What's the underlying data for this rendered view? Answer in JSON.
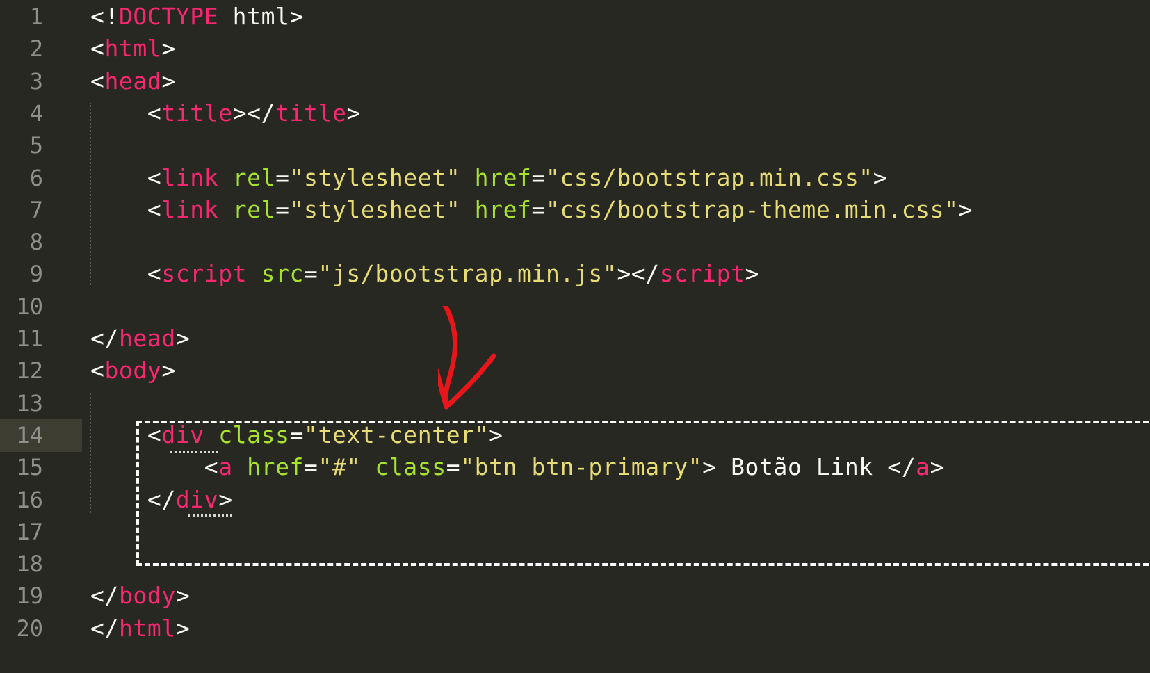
{
  "editor": {
    "active_line": 14,
    "lines": [
      {
        "n": "1",
        "tokens": [
          {
            "c": "p",
            "t": "<!"
          },
          {
            "c": "t",
            "t": "DOCTYPE"
          },
          {
            "c": "w",
            "t": " html"
          },
          {
            "c": "p",
            "t": ">"
          }
        ]
      },
      {
        "n": "2",
        "tokens": [
          {
            "c": "p",
            "t": "<"
          },
          {
            "c": "t",
            "t": "html"
          },
          {
            "c": "p",
            "t": ">"
          }
        ]
      },
      {
        "n": "3",
        "tokens": [
          {
            "c": "p",
            "t": "<"
          },
          {
            "c": "t",
            "t": "head"
          },
          {
            "c": "p",
            "t": ">"
          }
        ]
      },
      {
        "n": "4",
        "tokens": [
          {
            "c": "p",
            "t": "    <"
          },
          {
            "c": "t",
            "t": "title"
          },
          {
            "c": "p",
            "t": "></"
          },
          {
            "c": "t",
            "t": "title"
          },
          {
            "c": "p",
            "t": ">"
          }
        ]
      },
      {
        "n": "5",
        "tokens": []
      },
      {
        "n": "6",
        "tokens": [
          {
            "c": "p",
            "t": "    <"
          },
          {
            "c": "t",
            "t": "link"
          },
          {
            "c": "p",
            "t": " "
          },
          {
            "c": "a",
            "t": "rel"
          },
          {
            "c": "p",
            "t": "="
          },
          {
            "c": "s",
            "t": "\"stylesheet\""
          },
          {
            "c": "p",
            "t": " "
          },
          {
            "c": "a",
            "t": "href"
          },
          {
            "c": "p",
            "t": "="
          },
          {
            "c": "s",
            "t": "\"css/bootstrap.min.css\""
          },
          {
            "c": "p",
            "t": ">"
          }
        ]
      },
      {
        "n": "7",
        "tokens": [
          {
            "c": "p",
            "t": "    <"
          },
          {
            "c": "t",
            "t": "link"
          },
          {
            "c": "p",
            "t": " "
          },
          {
            "c": "a",
            "t": "rel"
          },
          {
            "c": "p",
            "t": "="
          },
          {
            "c": "s",
            "t": "\"stylesheet\""
          },
          {
            "c": "p",
            "t": " "
          },
          {
            "c": "a",
            "t": "href"
          },
          {
            "c": "p",
            "t": "="
          },
          {
            "c": "s",
            "t": "\"css/bootstrap-theme.min.css\""
          },
          {
            "c": "p",
            "t": ">"
          }
        ]
      },
      {
        "n": "8",
        "tokens": []
      },
      {
        "n": "9",
        "tokens": [
          {
            "c": "p",
            "t": "    <"
          },
          {
            "c": "t",
            "t": "script"
          },
          {
            "c": "p",
            "t": " "
          },
          {
            "c": "a",
            "t": "src"
          },
          {
            "c": "p",
            "t": "="
          },
          {
            "c": "s",
            "t": "\"js/bootstrap.min.js\""
          },
          {
            "c": "p",
            "t": "></"
          },
          {
            "c": "t",
            "t": "script"
          },
          {
            "c": "p",
            "t": ">"
          }
        ]
      },
      {
        "n": "10",
        "tokens": []
      },
      {
        "n": "11",
        "tokens": [
          {
            "c": "p",
            "t": "</"
          },
          {
            "c": "t",
            "t": "head"
          },
          {
            "c": "p",
            "t": ">"
          }
        ]
      },
      {
        "n": "12",
        "tokens": [
          {
            "c": "p",
            "t": "<"
          },
          {
            "c": "t",
            "t": "body"
          },
          {
            "c": "p",
            "t": ">"
          }
        ]
      },
      {
        "n": "13",
        "tokens": []
      },
      {
        "n": "14",
        "tokens": [
          {
            "c": "p",
            "t": "    <"
          },
          {
            "c": "t",
            "t": "div"
          },
          {
            "c": "p",
            "t": " "
          },
          {
            "c": "a",
            "t": "class"
          },
          {
            "c": "p",
            "t": "="
          },
          {
            "c": "s",
            "t": "\"text-center\""
          },
          {
            "c": "p",
            "t": ">"
          }
        ]
      },
      {
        "n": "15",
        "tokens": [
          {
            "c": "p",
            "t": "        <"
          },
          {
            "c": "t",
            "t": "a"
          },
          {
            "c": "p",
            "t": " "
          },
          {
            "c": "a",
            "t": "href"
          },
          {
            "c": "p",
            "t": "="
          },
          {
            "c": "s",
            "t": "\"#\""
          },
          {
            "c": "p",
            "t": " "
          },
          {
            "c": "a",
            "t": "class"
          },
          {
            "c": "p",
            "t": "="
          },
          {
            "c": "s",
            "t": "\"btn btn-primary\""
          },
          {
            "c": "p",
            "t": ">"
          },
          {
            "c": "w",
            "t": " Botão Link "
          },
          {
            "c": "p",
            "t": "</"
          },
          {
            "c": "t",
            "t": "a"
          },
          {
            "c": "p",
            "t": ">"
          }
        ]
      },
      {
        "n": "16",
        "tokens": [
          {
            "c": "p",
            "t": "    </"
          },
          {
            "c": "t",
            "t": "div"
          },
          {
            "c": "p",
            "t": ">"
          }
        ]
      },
      {
        "n": "17",
        "tokens": []
      },
      {
        "n": "18",
        "tokens": []
      },
      {
        "n": "19",
        "tokens": [
          {
            "c": "p",
            "t": "</"
          },
          {
            "c": "t",
            "t": "body"
          },
          {
            "c": "p",
            "t": ">"
          }
        ]
      },
      {
        "n": "20",
        "tokens": [
          {
            "c": "p",
            "t": "</"
          },
          {
            "c": "t",
            "t": "html"
          },
          {
            "c": "p",
            "t": ">"
          }
        ]
      }
    ]
  },
  "colors": {
    "background": "#272822",
    "tag": "#f92672",
    "attribute": "#a6e22e",
    "string": "#e6db74",
    "text": "#f8f8f2",
    "line_number": "#90908a",
    "annotation_arrow": "#e8161b",
    "annotation_box": "#ffffff"
  },
  "annotations": {
    "arrow_icon": "red-hand-drawn-arrow-icon",
    "box": "dashed-white-highlight-box"
  }
}
